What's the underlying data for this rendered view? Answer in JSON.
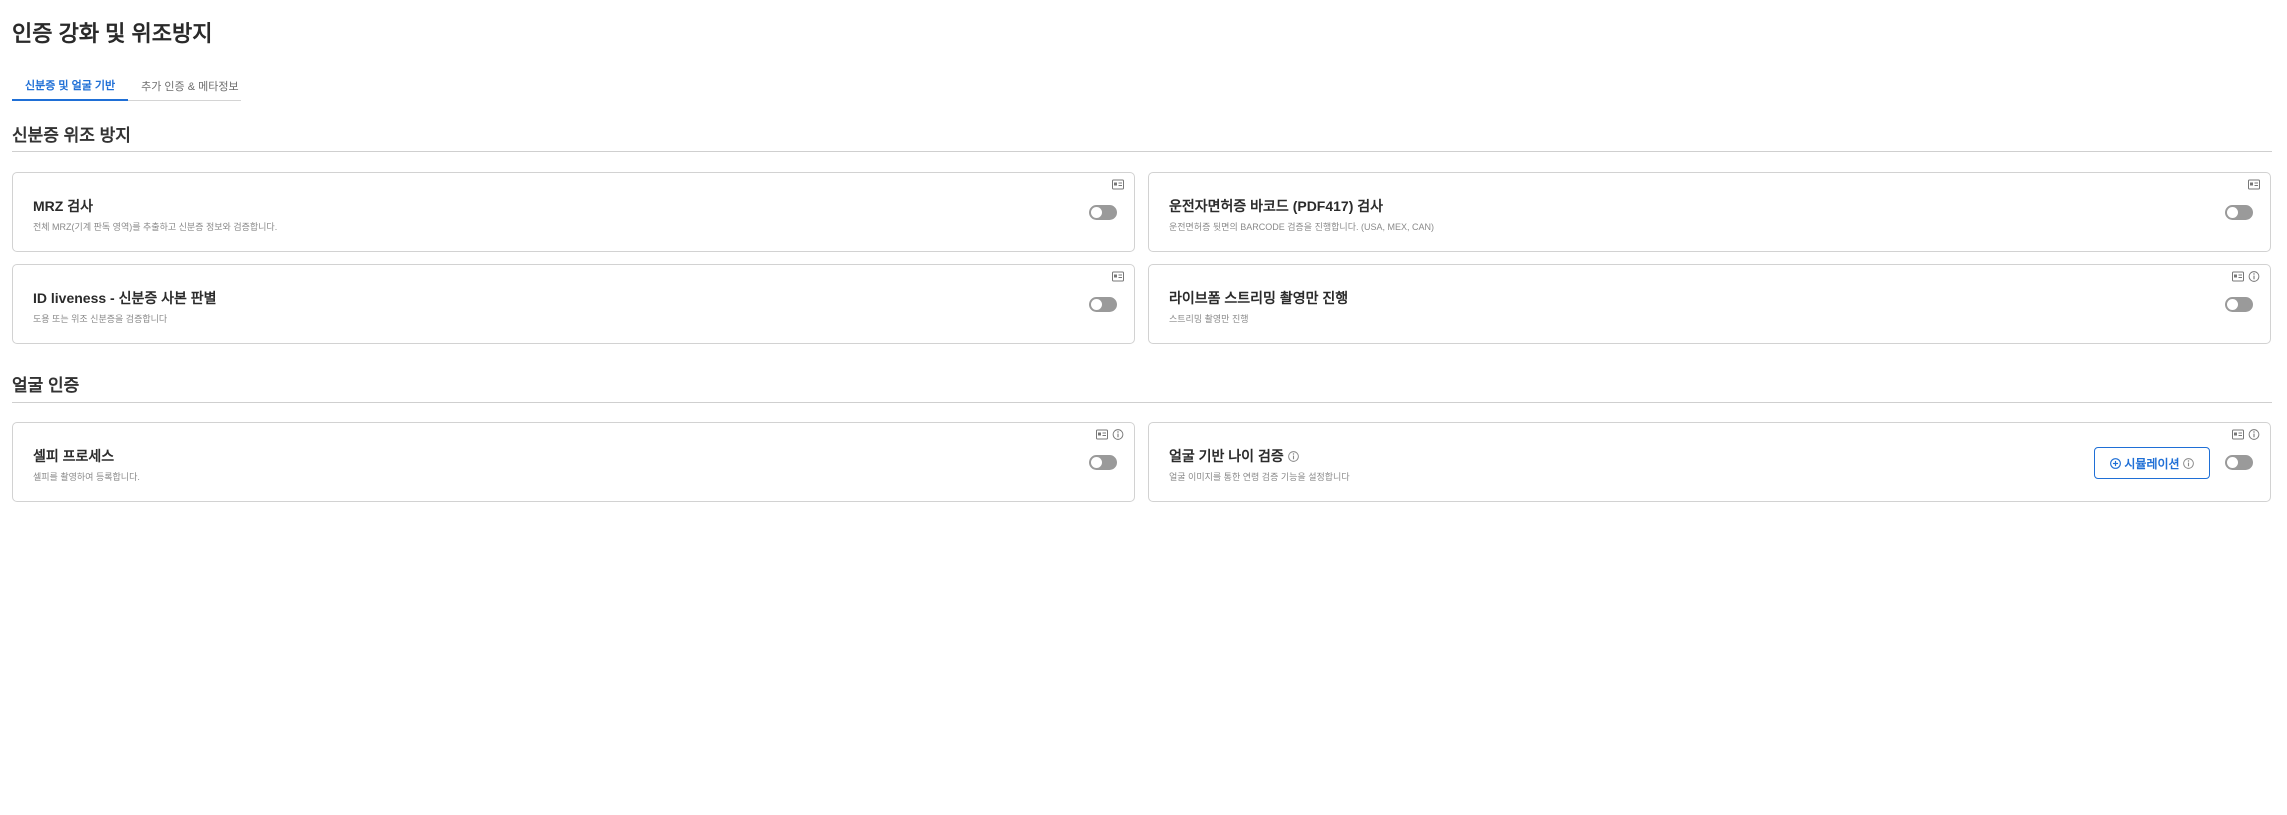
{
  "page": {
    "title": "인증 강화 및 위조방지"
  },
  "tabs": [
    {
      "label": "신분증 및 얼굴 기반",
      "active": true
    },
    {
      "label": "추가 인증 & 메타정보",
      "active": false
    }
  ],
  "sections": {
    "id_forgery": {
      "title": "신분증 위조 방지",
      "cards": {
        "mrz": {
          "title": "MRZ 검사",
          "desc": "전체 MRZ(기계 판독 영역)를 추출하고 신분증 정보와 검증합니다.",
          "enabled": false
        },
        "barcode": {
          "title": "운전자면허증 바코드 (PDF417) 검사",
          "desc": "운전면허증 뒷면의 BARCODE 검증을 진행합니다. (USA, MEX, CAN)",
          "enabled": false
        },
        "id_liveness": {
          "title": "ID liveness - 신분증 사본 판별",
          "desc": "도용 또는 위조 신분증을 검증합니다",
          "enabled": false
        },
        "live_stream": {
          "title": "라이브폼 스트리밍 촬영만 진행",
          "desc": "스트리밍 촬영만 진행",
          "enabled": false
        }
      }
    },
    "face": {
      "title": "얼굴 인증",
      "cards": {
        "selfie": {
          "title": "셀피 프로세스",
          "desc": "셀피를 촬영하여 등록합니다.",
          "enabled": false
        },
        "age": {
          "title": "얼굴 기반 나이 검증",
          "desc": "얼굴 이미지를 통한 연령 검증 기능을 설정합니다",
          "enabled": false,
          "simulation_label": "시뮬레이션"
        }
      }
    }
  },
  "icons": {
    "id_card": "id-card-icon",
    "info": "info-icon",
    "plus_circle": "plus-circle-icon"
  },
  "colors": {
    "accent": "#1f6fd6",
    "toggle_off": "#9a9a9a",
    "border": "#d2d2d2"
  }
}
